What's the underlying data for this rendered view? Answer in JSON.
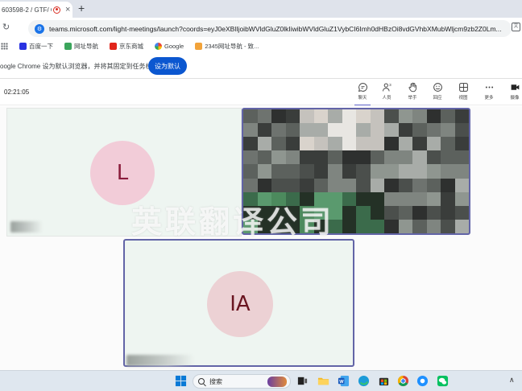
{
  "browser": {
    "tab_title": "603598-2 / GTF/ Gé",
    "tab_close": "×",
    "new_tab": "+",
    "url": "teams.microsoft.com/light-meetings/launch?coords=eyJ0eXBlIjoibWVldGluZ0lkIiwibWVldGluZ1VybCI6Imh0dHBzOi8vdGVhbXMubWljcm9zb2Z0Lm...",
    "bookmarks": [
      {
        "label": "百度一下",
        "icon": "baidu-icon",
        "color": "#2932e1"
      },
      {
        "label": "网址导航",
        "icon": "nav-icon",
        "color": "#3ba55c"
      },
      {
        "label": "京东商城",
        "icon": "jd-icon",
        "color": "#e1251b"
      },
      {
        "label": "Google",
        "icon": "google-icon",
        "color": "#4285f4"
      },
      {
        "label": "2345网址导航 - 致...",
        "icon": "nav2345-icon",
        "color": "#f2a33a"
      }
    ],
    "infobar_text": "oogle Chrome 设为默认浏览器，并将其固定到任务栏",
    "infobar_button": "设为默认"
  },
  "meeting": {
    "timer": "02:21:05",
    "toolbar": [
      {
        "label": "聊天",
        "icon": "chat-icon",
        "active": true
      },
      {
        "label": "人员",
        "icon": "people-icon",
        "badge": "3"
      },
      {
        "label": "举手",
        "icon": "raise-hand-icon"
      },
      {
        "label": "回应",
        "icon": "react-icon"
      },
      {
        "label": "视图",
        "icon": "view-icon"
      },
      {
        "label": "更多",
        "icon": "more-icon"
      },
      {
        "label": "摄像",
        "icon": "camera-icon"
      }
    ],
    "participants": [
      {
        "initials": "L"
      },
      {
        "initials": "IA"
      }
    ],
    "watermark": "英联翻译公司",
    "accent": "#6264a7"
  },
  "taskbar": {
    "search_placeholder": "搜索",
    "apps": [
      "start-icon",
      "widgets-icon",
      "task-view-icon",
      "file-explorer-icon",
      "word-icon",
      "edge-icon",
      "store-icon",
      "chrome-icon",
      "qq-browser-icon",
      "wechat-icon"
    ]
  }
}
